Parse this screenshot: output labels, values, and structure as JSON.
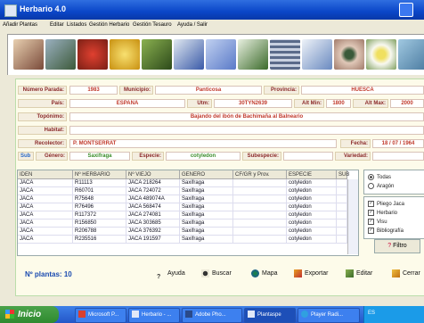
{
  "window": {
    "title": "Herbario 4.0"
  },
  "menu": {
    "items": [
      "Añadir Plantas",
      "Editar",
      "Listados",
      "Gestión Herbario",
      "Gestión Tesauro",
      "Ayuda / Salir"
    ]
  },
  "icons": [
    {
      "name": "flower-photo-icon",
      "color": "#7a4a3a"
    },
    {
      "name": "pine-photo-icon",
      "color": "#3d5a3a"
    },
    {
      "name": "red-flower-photo-icon",
      "color": "#c8322a"
    },
    {
      "name": "yellow-flower-photo-icon",
      "color": "#e6b020"
    },
    {
      "name": "plant-photo-icon",
      "color": "#4f7a2a"
    },
    {
      "name": "book-photo-icon",
      "color": "#3a5aa8"
    },
    {
      "name": "documents-photo-icon",
      "color": "#5a7ac8"
    },
    {
      "name": "herbarium-sheet-icon",
      "color": "#3b6a2a"
    },
    {
      "name": "grid-map-icon",
      "color": "#5a6a8a"
    },
    {
      "name": "brush-icon",
      "color": "#6a8ac0"
    },
    {
      "name": "eye-photo-icon",
      "color": "#a07a6a"
    },
    {
      "name": "daisy-photo-icon",
      "color": "#d0c080"
    },
    {
      "name": "butterfly-photo-icon",
      "color": "#4a7aa0"
    }
  ],
  "form": {
    "numero_parada_label": "Número Parada:",
    "numero_parada": "1983",
    "municipio_label": "Municipio:",
    "municipio": "Panticosa",
    "provincia_label": "Provincia:",
    "provincia": "HUESCA",
    "pais_label": "País:",
    "pais": "ESPAÑA",
    "utm_label": "Utm:",
    "utm": "30TYN2639",
    "alt_min_label": "Alt Min:",
    "alt_min": "1800",
    "alt_max_label": "Alt Max:",
    "alt_max": "2000",
    "toponimo_label": "Topónimo:",
    "toponimo": "Bajando del ibón de Bachimaña al Balneario",
    "habitat_label": "Habitat:",
    "habitat": "",
    "recolector_label": "Recolector:",
    "recolector": "P. MONTSERRAT",
    "fecha_label": "Fecha:",
    "fecha": "18 / 07 / 1964",
    "sub_label": "Sub",
    "genero_label": "Género:",
    "genero": "Saxifraga",
    "especie_label": "Especie:",
    "especie": "cotyledon",
    "subespecie_label": "Subespecie:",
    "subespecie": "",
    "variedad_label": "Variedad:",
    "variedad": ""
  },
  "table": {
    "columns": [
      "IDEN",
      "Nº HERBARIO",
      "Nº VIEJO",
      "GENERO",
      "CF/GR y Prov.",
      "ESPECIE",
      "SUB"
    ],
    "rows": [
      [
        "JACA",
        "R11113",
        "JACA 218264",
        "Saxifraga",
        "",
        "cotyledon",
        ""
      ],
      [
        "JACA",
        "R60701",
        "JACA 724072",
        "Saxifraga",
        "",
        "cotyledon",
        ""
      ],
      [
        "JACA",
        "R75648",
        "JACA 489074A",
        "Saxifraga",
        "",
        "cotyledon",
        ""
      ],
      [
        "JACA",
        "R76496",
        "JACA 568474",
        "Saxifraga",
        "",
        "cotyledon",
        ""
      ],
      [
        "JACA",
        "R117372",
        "JACA 274081",
        "Saxifraga",
        "",
        "cotyledon",
        ""
      ],
      [
        "JACA",
        "R156850",
        "JACA 303685",
        "Saxifraga",
        "",
        "cotyledon",
        ""
      ],
      [
        "JACA",
        "R206788",
        "JACA 376392",
        "Saxifraga",
        "",
        "cotyledon",
        ""
      ],
      [
        "JACA",
        "R235516",
        "JACA 191597",
        "Saxifraga",
        "",
        "cotyledon",
        ""
      ]
    ]
  },
  "filters": {
    "radios": [
      "Todas",
      "Aragón"
    ],
    "checks": [
      "Pliego Jaca",
      "Herbario",
      "Visu",
      "Bibliografía"
    ],
    "filter_button": "Filtro"
  },
  "footer": {
    "count_label": "Nº plantas: 10",
    "buttons": [
      "Ayuda",
      "Buscar",
      "Mapa",
      "Exportar",
      "Editar",
      "Cerrar"
    ]
  },
  "taskbar": {
    "start": "Inicio",
    "tasks": [
      "Microsoft P...",
      "Herbario - ...",
      "Adobe Pho...",
      "Plantaspe",
      "Player Radi..."
    ],
    "tray_label": "ES"
  }
}
